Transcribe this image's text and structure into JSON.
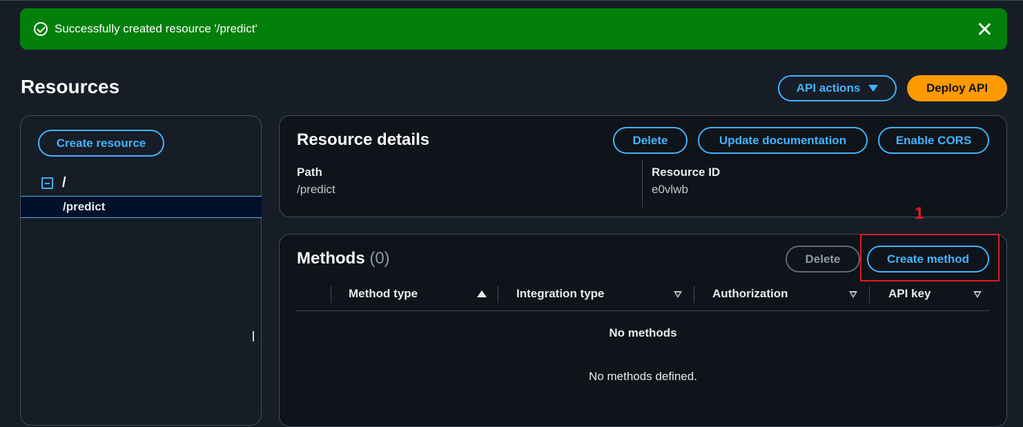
{
  "flash": {
    "message": "Successfully created resource '/predict'"
  },
  "header": {
    "title": "Resources",
    "api_actions_label": "API actions",
    "deploy_label": "Deploy API"
  },
  "sidebar": {
    "create_resource_label": "Create resource",
    "tree": [
      {
        "label": "/"
      },
      {
        "label": "/predict",
        "selected": true
      }
    ]
  },
  "details": {
    "title": "Resource details",
    "delete_label": "Delete",
    "update_doc_label": "Update documentation",
    "cors_label": "Enable CORS",
    "path_key": "Path",
    "path_value": "/predict",
    "resource_id_key": "Resource ID",
    "resource_id_value": "e0vlwb"
  },
  "methods": {
    "title": "Methods",
    "count": "(0)",
    "delete_label": "Delete",
    "create_label": "Create method",
    "columns": [
      "Method type",
      "Integration type",
      "Authorization",
      "API key"
    ],
    "empty_title": "No methods",
    "empty_desc": "No methods defined."
  },
  "annotation": {
    "number": "1"
  },
  "colors": {
    "accent": "#42b4ff",
    "primary": "#ff9900",
    "success": "#037f0c",
    "annotation": "#e01b24"
  }
}
